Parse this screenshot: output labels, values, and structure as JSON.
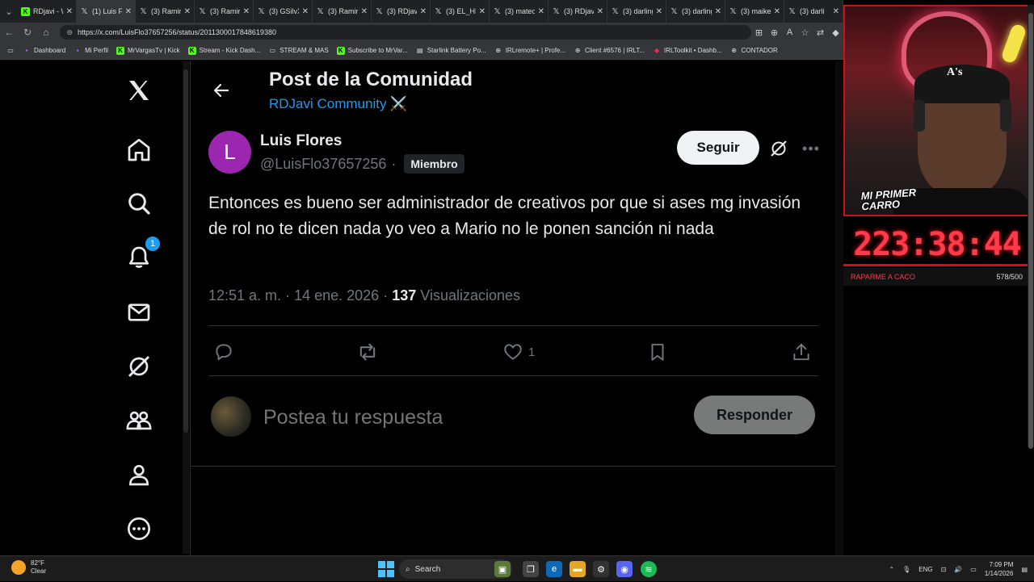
{
  "browser": {
    "tabs": [
      {
        "title": "RDjavi - W",
        "icon": "kick",
        "active": false
      },
      {
        "title": "(1) Luis Fl",
        "icon": "x",
        "active": true
      },
      {
        "title": "(3) Ramiro",
        "icon": "x",
        "active": false
      },
      {
        "title": "(3) Ramiro",
        "icon": "x",
        "active": false
      },
      {
        "title": "(3) GSilvX",
        "icon": "x",
        "active": false
      },
      {
        "title": "(3) Ramiro",
        "icon": "x",
        "active": false
      },
      {
        "title": "(3) RDjavi",
        "icon": "x",
        "active": false
      },
      {
        "title": "(3) EL_HE",
        "icon": "x",
        "active": false
      },
      {
        "title": "(3) mateo",
        "icon": "x",
        "active": false
      },
      {
        "title": "(3) RDjavi",
        "icon": "x",
        "active": false
      },
      {
        "title": "(3) darling",
        "icon": "x",
        "active": false
      },
      {
        "title": "(3) darling",
        "icon": "x",
        "active": false
      },
      {
        "title": "(3) maikel",
        "icon": "x",
        "active": false
      },
      {
        "title": "(3) darli",
        "icon": "x",
        "active": false
      }
    ],
    "url": "https://x.com/LuisFlo37657256/status/2011300017848619380",
    "bookmarks": [
      {
        "label": "Dashboard",
        "icon": "twitch"
      },
      {
        "label": "Mi Perfil",
        "icon": "twitch"
      },
      {
        "label": "MrVargasTv | Kick",
        "icon": "kick"
      },
      {
        "label": "Stream - Kick Dash...",
        "icon": "kick"
      },
      {
        "label": "STREAM & MAS",
        "icon": "folder"
      },
      {
        "label": "Subscribe to MrVar...",
        "icon": "kick"
      },
      {
        "label": "Starlink Battery Po...",
        "icon": "page"
      },
      {
        "label": "IRLremote+ | Profe...",
        "icon": "globe"
      },
      {
        "label": "Client #6576 | IRLT...",
        "icon": "globe"
      },
      {
        "label": "IRLToolkit • Dashb...",
        "icon": "irl"
      },
      {
        "label": "CONTADOR",
        "icon": "globe"
      }
    ]
  },
  "nav": {
    "notification_count": "1"
  },
  "header": {
    "title": "Post de la Comunidad",
    "community": "RDJavi Community",
    "community_emoji": "⚔️"
  },
  "post": {
    "avatar_letter": "L",
    "author_name": "Luis Flores",
    "handle": "@LuisFlo37657256",
    "dot": "·",
    "badge": "Miembro",
    "follow_label": "Seguir",
    "text": "Entonces es bueno ser administrador de creativos por que si ases mg invasión de rol no te dicen nada yo veo a Mario no le ponen sanción ni nada",
    "time": "12:51 a. m.",
    "date": "14 ene. 2026",
    "views_count": "137",
    "views_label": "Visualizaciones",
    "like_count": "1"
  },
  "reply": {
    "placeholder": "Postea tu respuesta",
    "button_label": "Responder"
  },
  "overlay": {
    "cam_label_line1": "MI PRIMER",
    "cam_label_line2": "CARRO",
    "cap_logo": "A's",
    "countdown": "223:38:44",
    "goal_label": "RAPARME A CACO",
    "goal_count": "578/500"
  },
  "taskbar": {
    "temp": "82°F",
    "weather": "Clear",
    "search_label": "Search",
    "lang": "ENG",
    "time": "7:09 PM",
    "date": "1/14/2026"
  }
}
